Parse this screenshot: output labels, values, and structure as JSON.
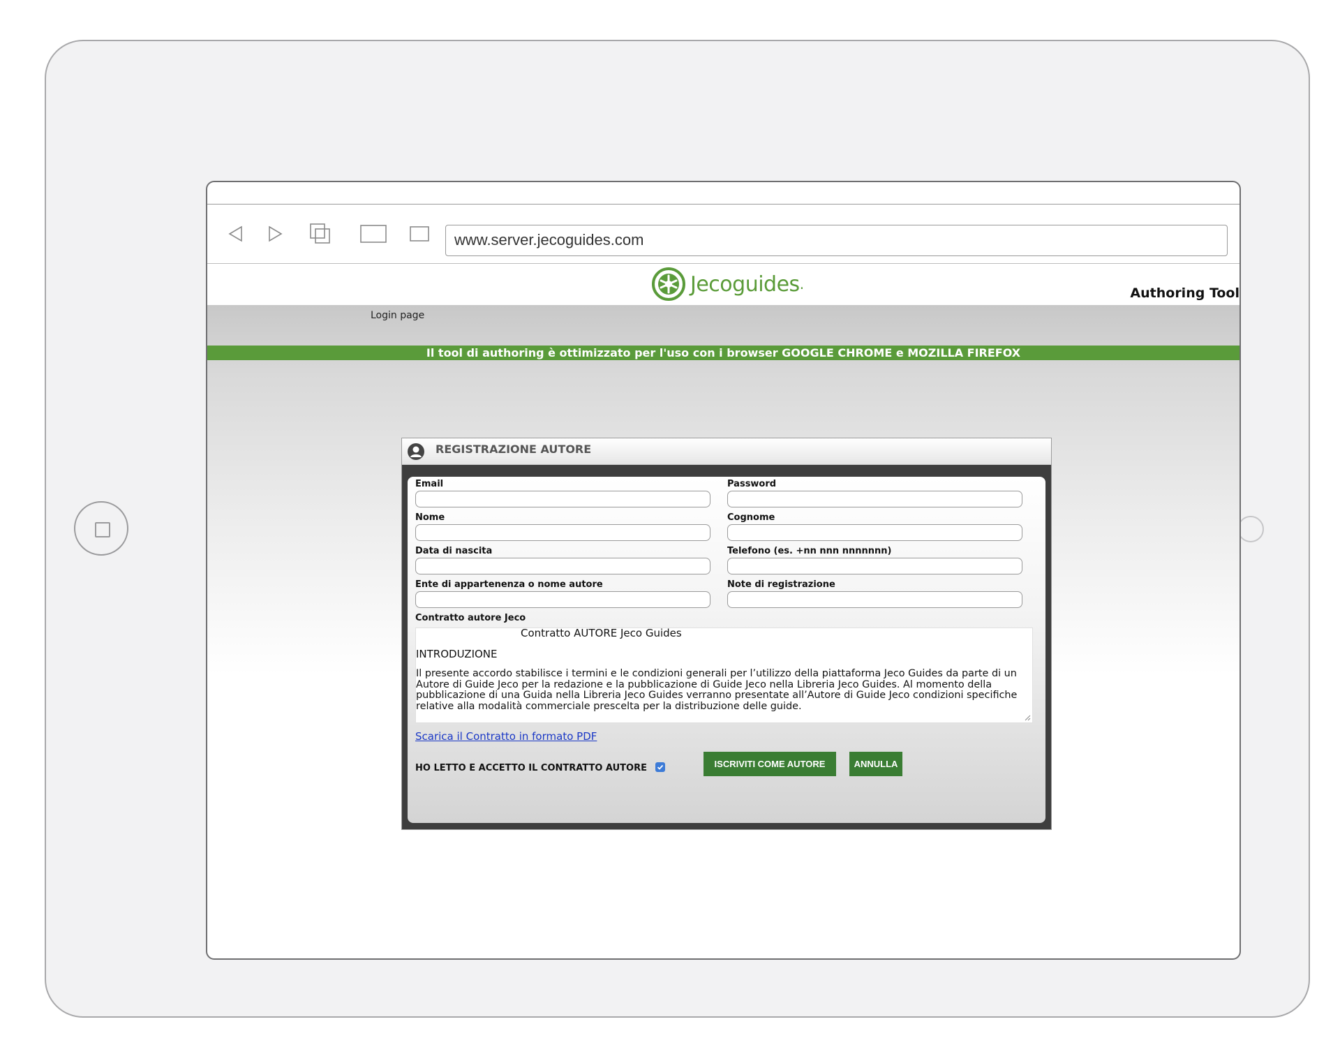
{
  "browser": {
    "url": "www.server.jecoguides.com"
  },
  "header": {
    "logo_text": "Jecoguides",
    "logo_suffix": ".",
    "tool_title": "Authoring Tool"
  },
  "breadcrumb": "Login page",
  "banner": "Il tool di authoring è ottimizzato per l'uso con i browser GOOGLE CHROME e MOZILLA FIREFOX",
  "dialog": {
    "title": "REGISTRAZIONE AUTORE",
    "fields": {
      "email": {
        "label": "Email",
        "value": ""
      },
      "password": {
        "label": "Password",
        "value": ""
      },
      "nome": {
        "label": "Nome",
        "value": ""
      },
      "cognome": {
        "label": "Cognome",
        "value": ""
      },
      "data_nascita": {
        "label": "Data di nascita",
        "value": ""
      },
      "telefono": {
        "label": "Telefono (es. +nn nnn nnnnnnn)",
        "value": ""
      },
      "ente": {
        "label": "Ente di appartenenza o nome autore",
        "value": ""
      },
      "note": {
        "label": "Note di registrazione",
        "value": ""
      }
    },
    "contract": {
      "label": "Contratto autore Jeco",
      "title": "Contratto AUTORE Jeco Guides",
      "intro": "INTRODUZIONE",
      "text": "Il presente accordo stabilisce i termini e le condizioni generali per l’utilizzo della piattaforma Jeco Guides da parte di un Autore di Guide Jeco per la redazione e la pubblicazione di Guide Jeco nella Libreria Jeco Guides. Al momento della pubblicazione di una Guida nella Libreria Jeco Guides verranno presentate all’Autore di Guide Jeco condizioni specifiche relative alla modalità commerciale prescelta per la distribuzione delle guide."
    },
    "pdf_link": "Scarica il Contratto in formato PDF",
    "accept_label": "HO LETTO E ACCETTO IL CONTRATTO AUTORE",
    "accept_checked": true,
    "submit_label": "ISCRIVITI COME AUTORE",
    "cancel_label": "ANNULLA"
  },
  "colors": {
    "brand_green": "#5a9b3a",
    "button_green": "#3a7d33",
    "checkbox_blue": "#3d7bd7",
    "link_blue": "#1a38c6"
  }
}
